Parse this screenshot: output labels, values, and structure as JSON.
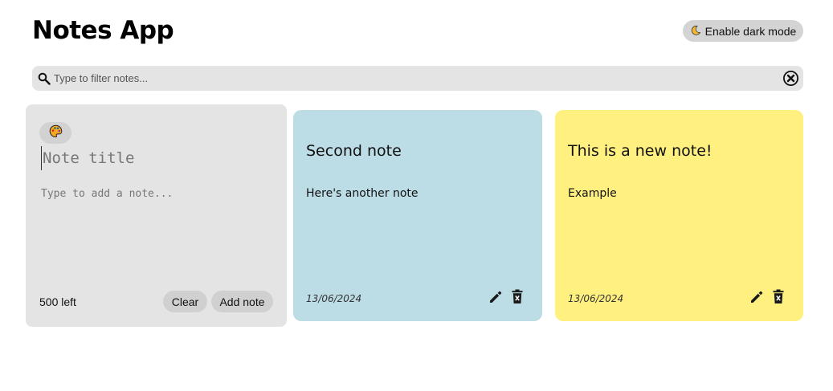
{
  "header": {
    "title": "Notes App",
    "dark_mode_label": "Enable dark mode",
    "dark_mode_icon": "moon-icon"
  },
  "search": {
    "placeholder": "Type to filter notes...",
    "value": "",
    "icon": "search-icon",
    "clear_icon": "circle-x-icon"
  },
  "new_note": {
    "palette_icon": "palette-icon",
    "title_placeholder": "Note title",
    "body_placeholder": "Type to add a note...",
    "chars_left": "500 left",
    "clear_label": "Clear",
    "add_label": "Add note"
  },
  "notes": [
    {
      "title": "Second note",
      "body": "Here's another note",
      "date": "13/06/2024",
      "color": "#bcdce6"
    },
    {
      "title": "This is a new note!",
      "body": "Example",
      "date": "13/06/2024",
      "color": "#fff080"
    }
  ],
  "colors": {
    "panel_gray": "#e4e4e4",
    "button_gray": "#d0d0d0",
    "moon_accent": "#e8a317"
  }
}
